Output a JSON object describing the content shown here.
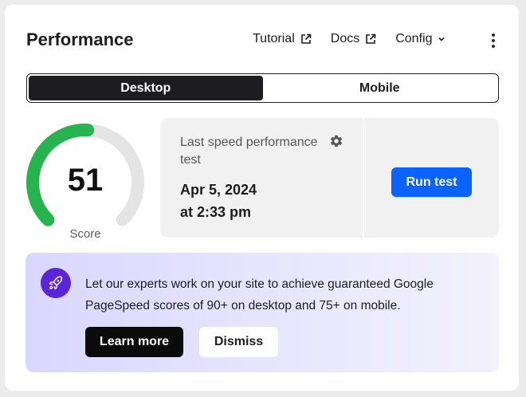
{
  "header": {
    "title": "Performance",
    "links": {
      "tutorial": "Tutorial",
      "docs": "Docs",
      "config": "Config"
    }
  },
  "device_toggle": {
    "desktop": "Desktop",
    "mobile": "Mobile",
    "selected": "Desktop"
  },
  "score": {
    "value": "51",
    "label": "Score",
    "fraction": 0.51,
    "color": "#27b34e",
    "track_color": "#e4e4e4"
  },
  "speed_test": {
    "label": "Last speed performance test",
    "date": "Apr 5, 2024",
    "time": "at 2:33 pm",
    "run_button": "Run test",
    "settings_icon": "gear-icon"
  },
  "promo": {
    "text": "Let our experts work on your site to achieve guaranteed Google PageSpeed scores of 90+ on desktop and 75+ on mobile.",
    "learn_more": "Learn more",
    "dismiss": "Dismiss",
    "icon": "rocket-icon"
  },
  "colors": {
    "accent_blue": "#0a62ff",
    "promo_icon_bg": "#5b24d6",
    "dark": "#1d1d1f"
  }
}
